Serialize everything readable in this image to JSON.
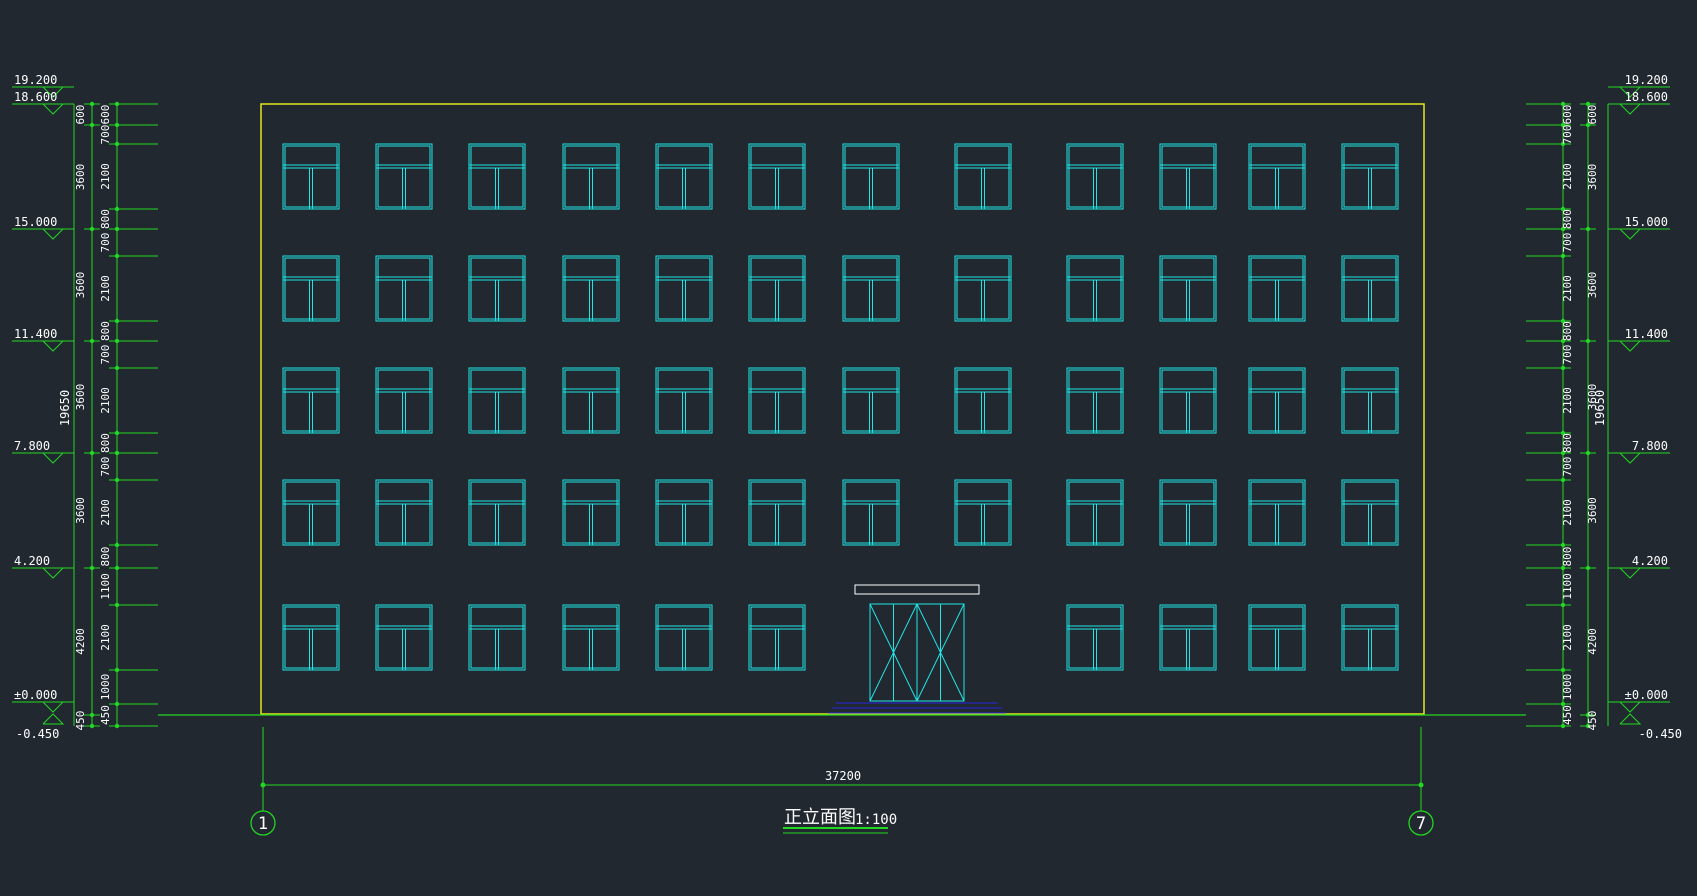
{
  "drawing": {
    "title": "正立面图",
    "scale": "1:100",
    "overall_width": "37200",
    "axis_left": "1",
    "axis_right": "7",
    "total_height": "19650"
  },
  "elevations": [
    "19.200",
    "18.600",
    "15.000",
    "11.400",
    "7.800",
    "4.200",
    "±0.000",
    "-0.450"
  ],
  "outer_dims": [
    "600",
    "3600",
    "3600",
    "3600",
    "3600",
    "4200",
    "450"
  ],
  "inner_dims": [
    "600",
    "700",
    "2100",
    "800",
    "700",
    "2100",
    "800",
    "700",
    "2100",
    "800",
    "700",
    "2100",
    "800",
    "1100",
    "2100",
    "1000",
    "450"
  ],
  "colors": {
    "background": "#212830",
    "dimension": "#22d722",
    "outline": "#e6e61e",
    "window": "#1ee6e6",
    "text": "#ffffff",
    "steps": "#2626e0"
  }
}
